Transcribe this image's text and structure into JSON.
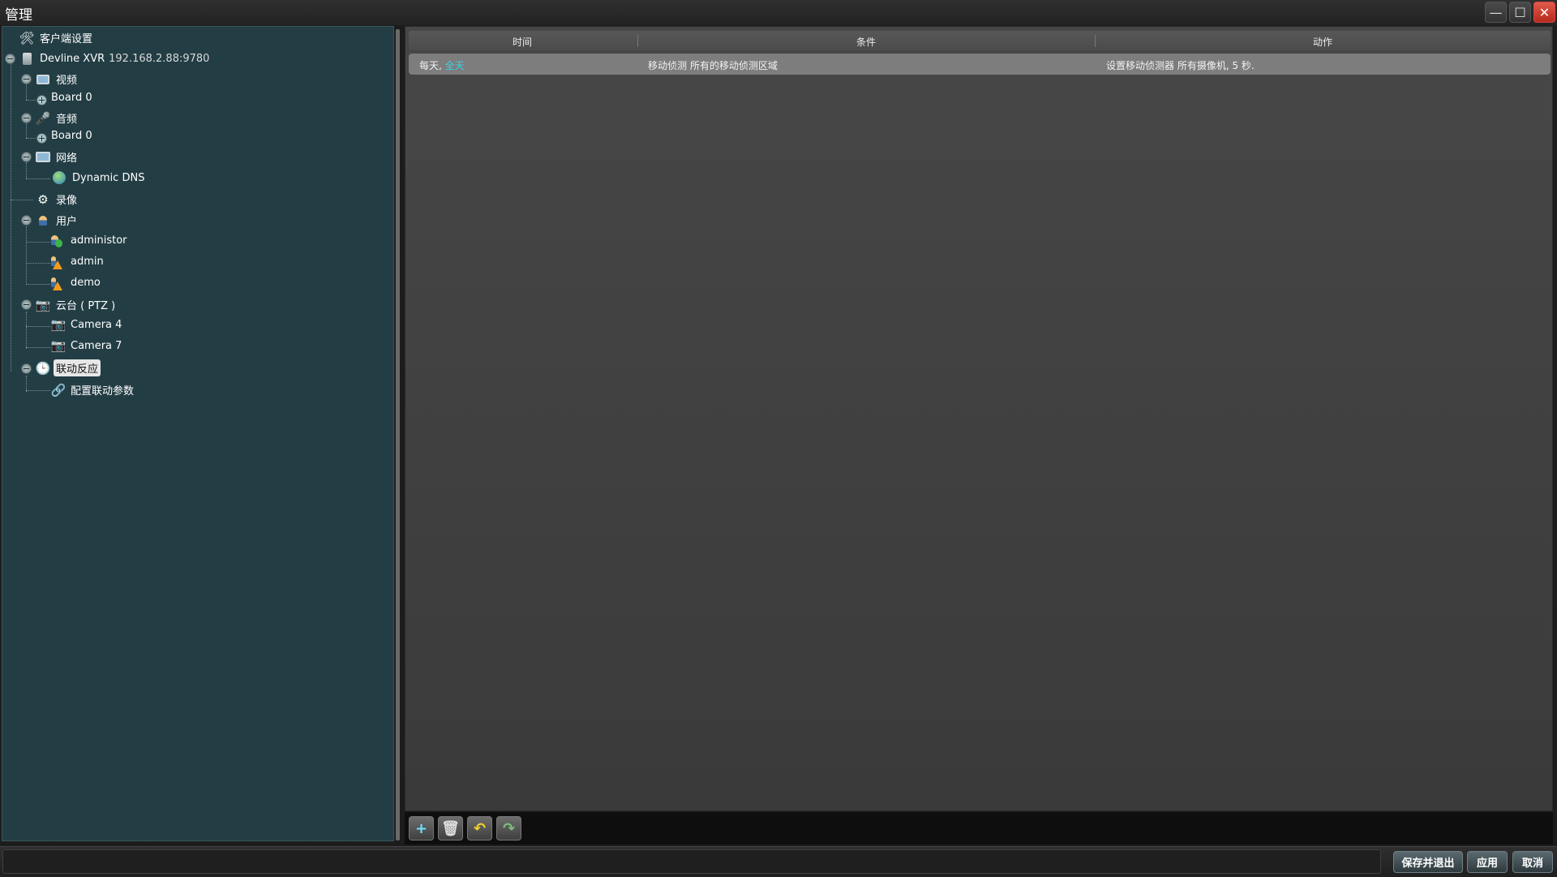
{
  "window": {
    "title": "管理",
    "minimize_label": "—",
    "maximize_label": "☐",
    "close_label": "✕"
  },
  "tree": {
    "client_settings": "客户端设置",
    "device": {
      "name": "Devline XVR",
      "address": "192.168.2.88:9780"
    },
    "video": {
      "label": "视频",
      "child": "Board 0"
    },
    "audio": {
      "label": "音频",
      "child": "Board 0"
    },
    "network": {
      "label": "网络",
      "child": "Dynamic DNS"
    },
    "recording": "录像",
    "users": {
      "label": "用户",
      "children": [
        "administor",
        "admin",
        "demo"
      ]
    },
    "ptz": {
      "label": "云台 ( PTZ )",
      "children": [
        "Camera 4",
        "Camera 7"
      ]
    },
    "linkage": {
      "label": "联动反应",
      "child": "配置联动参数"
    }
  },
  "table": {
    "columns": [
      "时间",
      "条件",
      "动作"
    ],
    "rows": [
      {
        "time_prefix": "每天,",
        "time_accent": "全天",
        "condition": "移动侦测 所有的移动侦测区域",
        "action": "设置移动侦测器 所有摄像机, 5 秒."
      }
    ]
  },
  "toolbar": {
    "add": "+",
    "delete": "🗑",
    "undo": "↶",
    "redo": "↷"
  },
  "footer": {
    "save_exit": "保存并退出",
    "apply": "应用",
    "cancel": "取消"
  },
  "colors": {
    "tree_bg": "#233d44",
    "accent": "#2fd6ea",
    "warning": "#f29a1c",
    "ok": "#3bb54a"
  }
}
